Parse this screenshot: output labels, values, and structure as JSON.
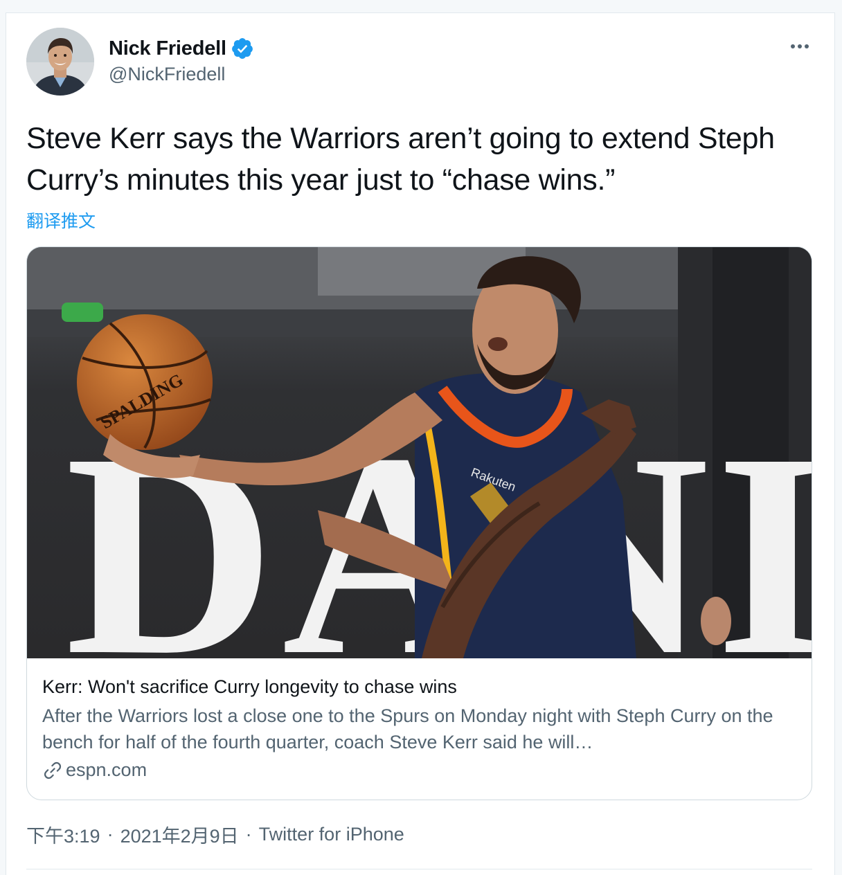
{
  "author": {
    "display_name": "Nick Friedell",
    "handle": "@NickFriedell",
    "verified": true
  },
  "tweet": {
    "text": "Steve Kerr says the Warriors aren’t going to extend Steph Curry’s minutes this year just to “chase wins.”",
    "translate_label": "翻译推文"
  },
  "card": {
    "title": "Kerr: Won't sacrifice Curry longevity to chase wins",
    "description": "After the Warriors lost a close one to the Spurs on Monday night with Steph Curry on the bench for half of the fourth quarter, coach Steve Kerr said he will…",
    "domain": "espn.com",
    "image_text": {
      "ball_brand": "SPALDING",
      "sponsor_patch": "Rakuten",
      "arena_sign": "DANIEL'S"
    }
  },
  "meta": {
    "time": "下午3:19",
    "date": "2021年2月9日",
    "source": "Twitter for iPhone",
    "separator": "·"
  },
  "colors": {
    "accent": "#1d9bf0",
    "secondary_text": "#536471",
    "jersey_navy": "#1d2a4d",
    "jersey_orange": "#e8551a"
  },
  "icons": [
    "verified-badge-icon",
    "more-dots-icon",
    "link-icon"
  ]
}
